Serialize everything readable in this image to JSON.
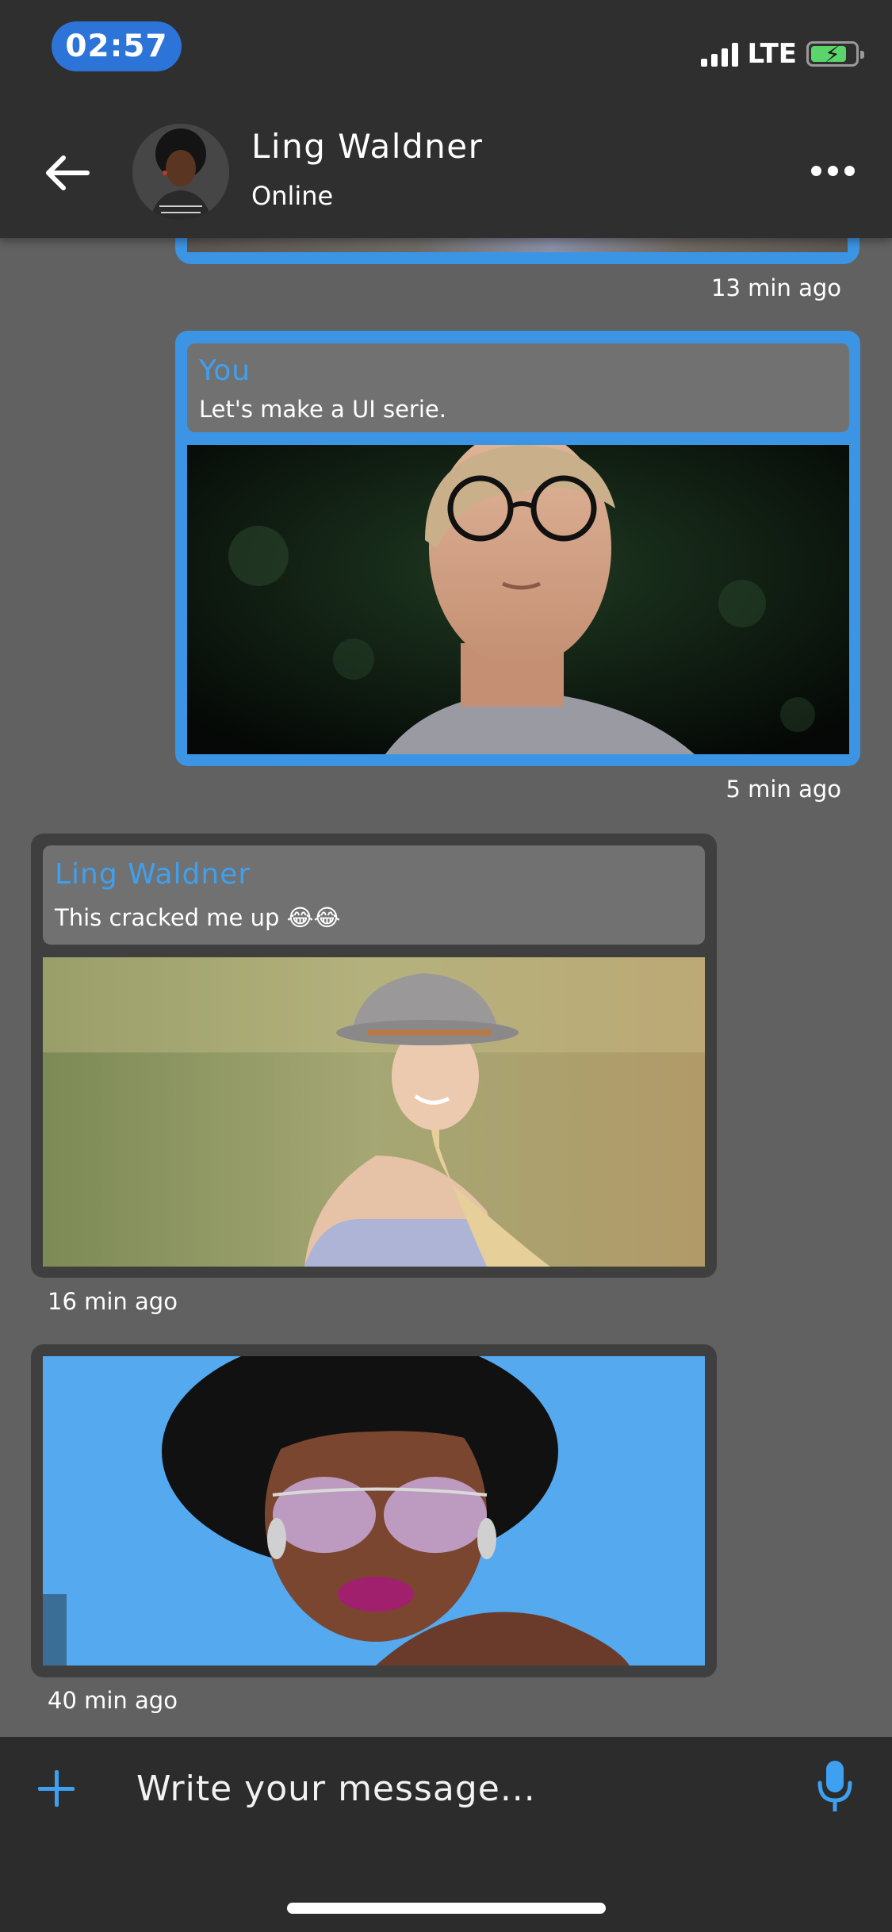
{
  "status_bar": {
    "time": "02:57",
    "network": "LTE"
  },
  "header": {
    "back_icon": "arrow-left-icon",
    "contact_name": "Ling Waldner",
    "contact_status": "Online",
    "more_icon": "more-dots-icon"
  },
  "messages": [
    {
      "sender": "",
      "text": "",
      "timestamp": "13 min ago",
      "from_me": true
    },
    {
      "sender": "You",
      "text": "Let's make a UI serie.",
      "timestamp": "5 min ago",
      "from_me": true
    },
    {
      "sender": "Ling Waldner",
      "text": "This cracked me up 😂😂",
      "timestamp": "16 min ago",
      "from_me": false
    },
    {
      "sender": "",
      "text": "",
      "timestamp": "40 min ago",
      "from_me": false
    }
  ],
  "composer": {
    "placeholder": "Write your message...",
    "add_icon": "plus-icon",
    "mic_icon": "microphone-icon"
  },
  "colors": {
    "accent": "#3c95e4",
    "background": "#616161",
    "bar": "#2f2f2f",
    "their_bubble": "#3f3f3f"
  }
}
